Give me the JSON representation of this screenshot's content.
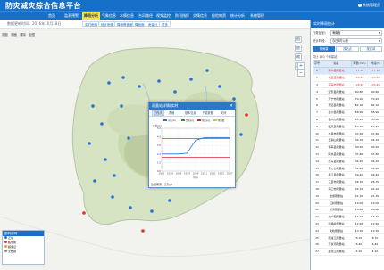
{
  "header": {
    "title": "防灾减灾综合信息平台",
    "user": "系统管理员"
  },
  "nav": [
    "首页",
    "监测预警",
    "降雨分析",
    "气象信息",
    "水情信息",
    "台风路径",
    "视频监控",
    "防汛指挥",
    "灾情信息",
    "抢险物资",
    "统计分析",
    "系统管理"
  ],
  "nav_active_index": 2,
  "sub_bar": {
    "text": "数据更新时间：2016年10月18日",
    "tabs": [
      "实时雨情",
      "统计雨情",
      "降雨等值面",
      "降雨面",
      "雨量计",
      "更多"
    ]
  },
  "map_toolbar": [
    "测距",
    "测面",
    "清除",
    "全图"
  ],
  "right_toolbar": [
    "图层",
    "放大",
    "缩小",
    "漫游"
  ],
  "legend": {
    "title": "图例说明",
    "items": [
      {
        "label": "正常",
        "color": "#2b72d8"
      },
      {
        "label": "超警戒",
        "color": "#e53030"
      },
      {
        "label": "超保证",
        "color": "#ff9a1c"
      },
      {
        "label": "无数据",
        "color": "#888888"
      }
    ]
  },
  "popup": {
    "title": "雨量站详情(实时)",
    "tabs": [
      "过程线",
      "表格",
      "基本信息",
      "下载数据",
      "关闭"
    ],
    "footer": "数据来源：三防办"
  },
  "chart_data": {
    "type": "line",
    "title": "",
    "legend": [
      "水位(m)",
      "警戒水位",
      "保证水位",
      "降雨量"
    ],
    "x": [
      "10/01",
      "10/03",
      "10/05",
      "10/07",
      "10/09",
      "10/11",
      "10/13",
      "10/15",
      "10/17"
    ],
    "series": [
      {
        "name": "水位(m)",
        "color": "#2b72d8",
        "values": [
          2.0,
          2.0,
          2.0,
          2.1,
          3.6,
          3.9,
          3.9,
          3.9,
          3.9
        ]
      },
      {
        "name": "警戒水位",
        "color": "#1f9a37",
        "values": [
          3.8,
          3.8,
          3.8,
          3.8,
          3.8,
          3.8,
          3.8,
          3.8,
          3.8
        ]
      },
      {
        "name": "保证水位",
        "color": "#d9262b",
        "values": [
          1.6,
          1.6,
          1.6,
          1.6,
          1.6,
          1.6,
          1.6,
          1.6,
          1.6
        ]
      }
    ],
    "ylim": [
      0,
      5
    ],
    "ylabel": "水位(m)",
    "xlabel": "时间",
    "grid": true
  },
  "right_panel": {
    "title": "实时降雨统计",
    "fields": [
      {
        "label": "行政区划：",
        "value": "海南省"
      },
      {
        "label": "统计时段：",
        "value": "今日8时以来"
      }
    ],
    "tools": [
      "按雨量",
      "按站点",
      "按区域"
    ],
    "subtitle": "共计 150 个雨量站",
    "columns": [
      "序号",
      "站名",
      "雨量(mm)",
      "时段(h)"
    ],
    "rows": [
      {
        "no": "1",
        "name": "琼中县雨量站",
        "v1": "177.10",
        "v2": "177.10",
        "red": true
      },
      {
        "no": "2",
        "name": "屯昌县雨量站",
        "v1": "133.30",
        "v2": "133.30",
        "red": true
      },
      {
        "no": "3",
        "name": "琼海市雨量站",
        "v1": "105.40",
        "v2": "105.40",
        "red": true
      },
      {
        "no": "4",
        "name": "定安县雨量站",
        "v1": "90.80",
        "v2": "90.80",
        "red": false
      },
      {
        "no": "5",
        "name": "万宁市雨量站",
        "v1": "70.20",
        "v2": "70.20",
        "red": false
      },
      {
        "no": "6",
        "name": "澄迈县雨量站",
        "v1": "62.10",
        "v2": "62.10",
        "red": false
      },
      {
        "no": "7",
        "name": "白沙县雨量站",
        "v1": "58.90",
        "v2": "58.90",
        "red": false
      },
      {
        "no": "8",
        "name": "儋州市雨量站",
        "v1": "55.20",
        "v2": "55.20",
        "red": false
      },
      {
        "no": "9",
        "name": "临高县雨量站",
        "v1": "50.30",
        "v2": "50.30",
        "red": false
      },
      {
        "no": "10",
        "name": "文昌市雨量站",
        "v1": "47.60",
        "v2": "47.60",
        "red": false
      },
      {
        "no": "11",
        "name": "五指山雨量站",
        "v1": "44.10",
        "v2": "44.10",
        "red": false
      },
      {
        "no": "12",
        "name": "保亭县雨量站",
        "v1": "40.50",
        "v2": "40.50",
        "red": false
      },
      {
        "no": "13",
        "name": "陵水县雨量站",
        "v1": "37.80",
        "v2": "37.80",
        "red": false
      },
      {
        "no": "14",
        "name": "乐东县雨量站",
        "v1": "34.20",
        "v2": "34.20",
        "red": false
      },
      {
        "no": "15",
        "name": "东方市雨量站",
        "v1": "31.90",
        "v2": "31.90",
        "red": false
      },
      {
        "no": "16",
        "name": "昌江县雨量站",
        "v1": "29.40",
        "v2": "29.40",
        "red": false
      },
      {
        "no": "17",
        "name": "三亚市雨量站",
        "v1": "26.70",
        "v2": "26.70",
        "red": false
      },
      {
        "no": "18",
        "name": "海口市雨量站",
        "v1": "24.10",
        "v2": "24.10",
        "red": false
      },
      {
        "no": "19",
        "name": "龙塘雨量站",
        "v1": "21.30",
        "v2": "21.30",
        "red": false
      },
      {
        "no": "20",
        "name": "红岭雨量站",
        "v1": "19.00",
        "v2": "19.00",
        "red": false
      },
      {
        "no": "21",
        "name": "松涛雨量站",
        "v1": "16.80",
        "v2": "16.80",
        "red": false
      },
      {
        "no": "22",
        "name": "大广坝雨量站",
        "v1": "14.20",
        "v2": "14.20",
        "red": false
      },
      {
        "no": "23",
        "name": "牛路岭雨量站",
        "v1": "12.60",
        "v2": "12.60",
        "red": false
      },
      {
        "no": "24",
        "name": "戈枕雨量站",
        "v1": "10.30",
        "v2": "10.30",
        "red": false
      },
      {
        "no": "25",
        "name": "南渡江雨量站",
        "v1": "8.70",
        "v2": "8.70",
        "red": false
      },
      {
        "no": "26",
        "name": "万泉河雨量站",
        "v1": "6.40",
        "v2": "6.40",
        "red": false
      },
      {
        "no": "27",
        "name": "昌化江雨量站",
        "v1": "4.10",
        "v2": "4.10",
        "red": false
      }
    ],
    "selected_row": 0
  }
}
